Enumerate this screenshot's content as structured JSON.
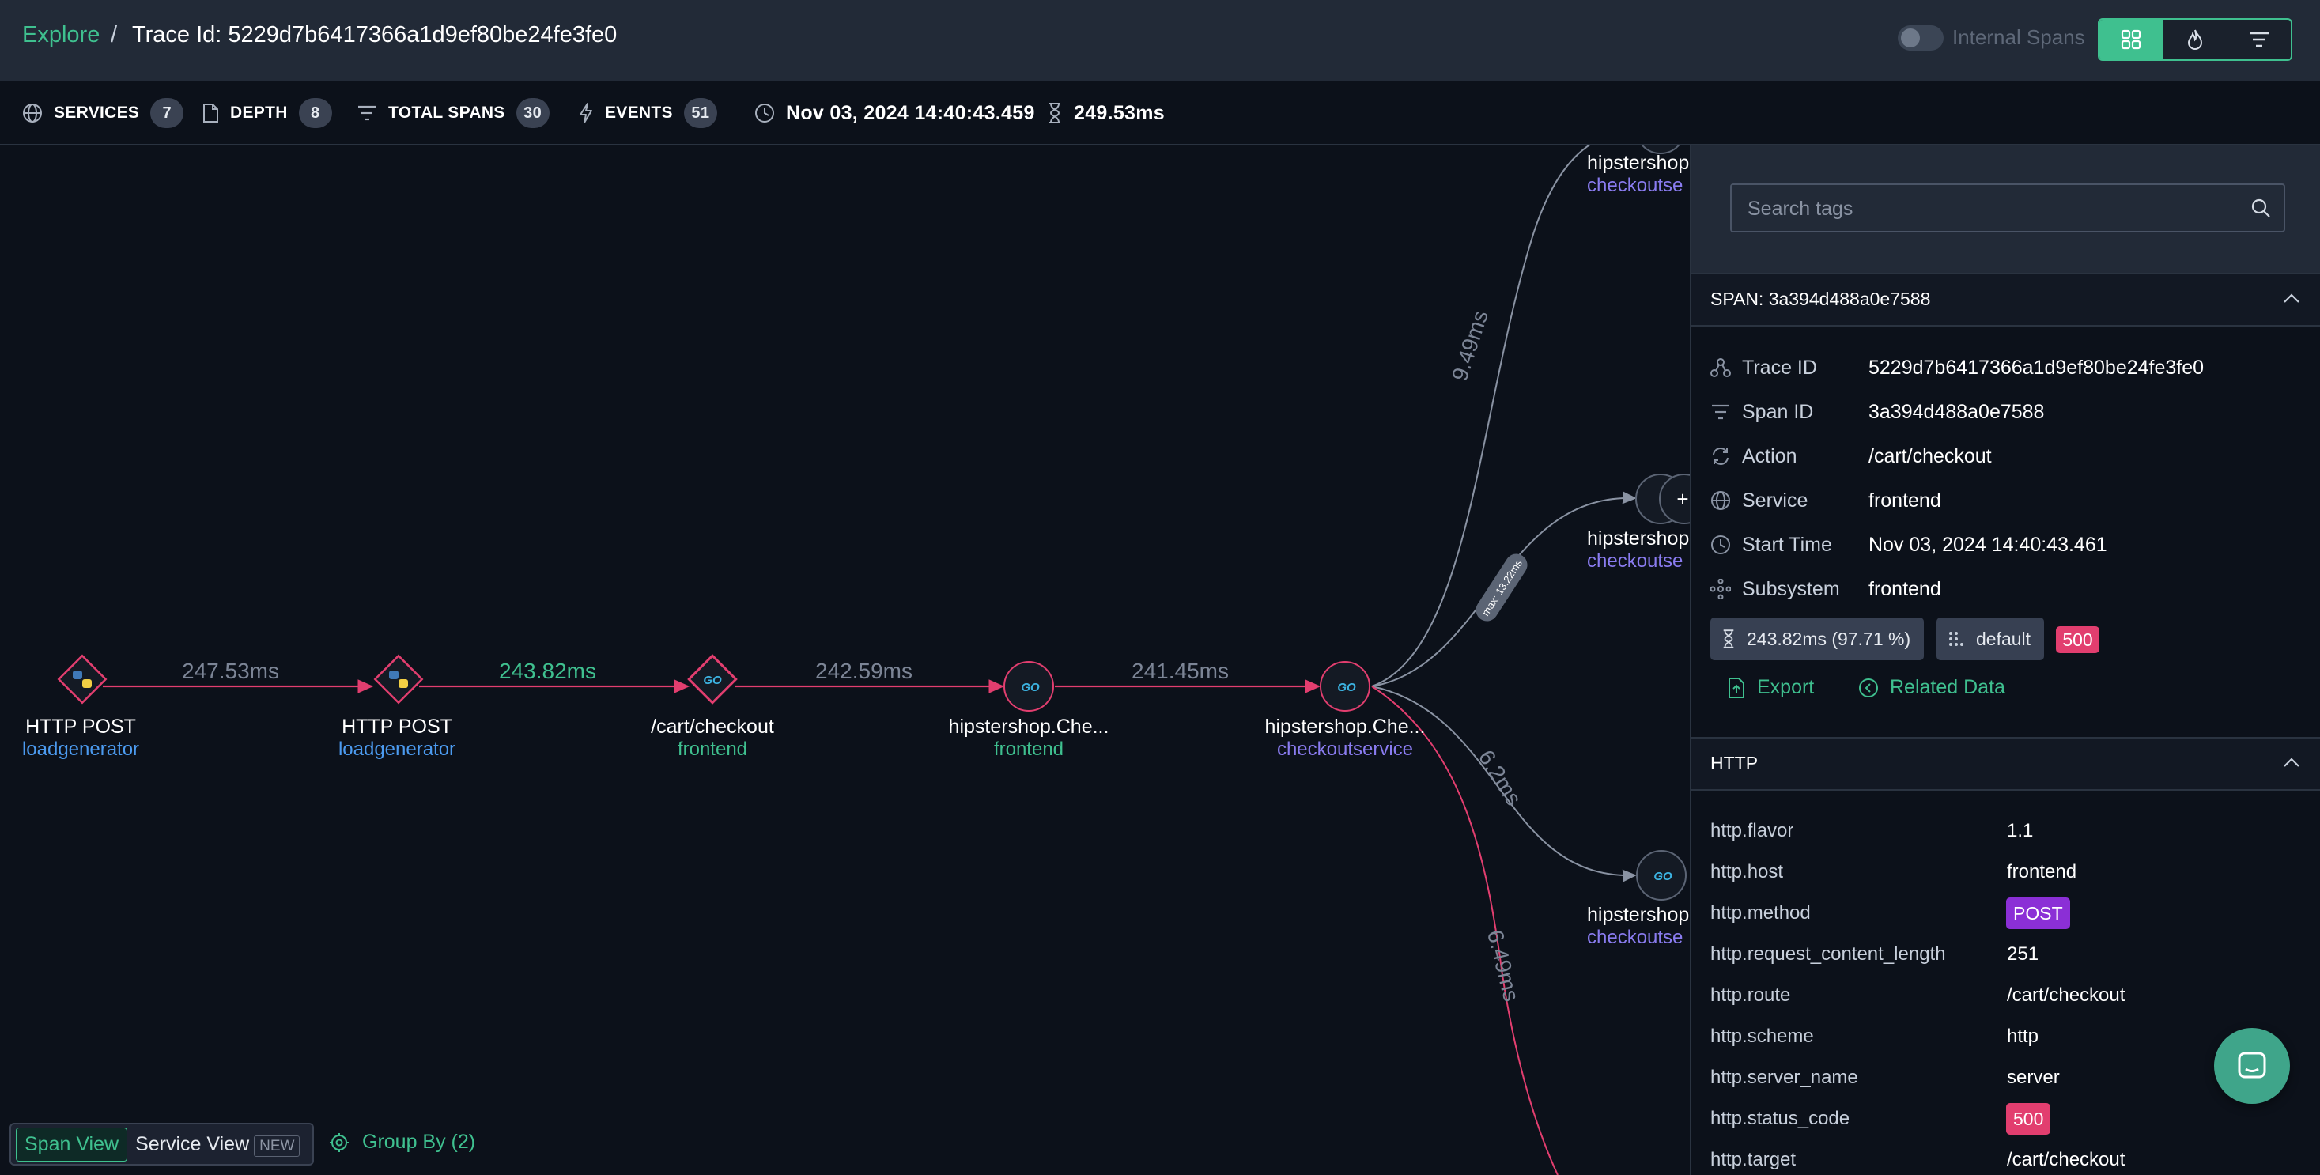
{
  "header": {
    "breadcrumb_root": "Explore",
    "separator": "/",
    "trace_title": "Trace Id: 5229d7b6417366a1d9ef80be24fe3fe0",
    "internal_spans_label": "Internal Spans",
    "internal_spans_enabled": false,
    "view_buttons": [
      "graph-view-icon",
      "flame-view-icon",
      "list-view-icon"
    ],
    "active_view": "graph-view-icon"
  },
  "stats": {
    "services_label": "SERVICES",
    "services_count": "7",
    "depth_label": "DEPTH",
    "depth_count": "8",
    "spans_label": "TOTAL SPANS",
    "spans_count": "30",
    "events_label": "EVENTS",
    "events_count": "51",
    "start_time": "Nov 03, 2024 14:40:43.459",
    "duration": "249.53ms"
  },
  "graph": {
    "nodes": [
      {
        "title": "HTTP POST",
        "service": "loadgenerator",
        "icon": "python-icon"
      },
      {
        "title": "HTTP POST",
        "service": "loadgenerator",
        "icon": "python-icon"
      },
      {
        "title": "/cart/checkout",
        "service": "frontend",
        "icon": "go-icon"
      },
      {
        "title": "hipstershop.Che...",
        "service": "frontend",
        "icon": "go-icon"
      },
      {
        "title": "hipstershop.Che...",
        "service": "checkoutservice",
        "icon": "go-icon"
      },
      {
        "title": "hipstershop",
        "service": "checkoutse",
        "icon": "go-icon"
      },
      {
        "title": "hipstershop",
        "service": "checkoutse",
        "icon": "go-icon"
      },
      {
        "title": "hipstershop",
        "service": "checkoutse",
        "icon": "go-icon"
      }
    ],
    "edges": [
      "247.53ms",
      "243.82ms",
      "242.59ms",
      "241.45ms",
      "9.49ms",
      "max: 13.22ms",
      "6.2ms",
      "6.49ms"
    ],
    "colors": {
      "error": "#e23e6f",
      "highlight": "#3fc08f",
      "muted": "#7c8596",
      "frontend": "#3fc08f",
      "loadgenerator": "#4c9bf0",
      "checkoutservice": "#8a7cf0"
    }
  },
  "bottom": {
    "span_view": "Span View",
    "service_view": "Service View",
    "new_tag": "NEW",
    "group_by": "Group By (2)"
  },
  "panel": {
    "search_placeholder": "Search tags",
    "span_section": "SPAN: 3a394d488a0e7588",
    "fields": [
      {
        "icon": "trace-icon",
        "key": "Trace ID",
        "value": "5229d7b6417366a1d9ef80be24fe3fe0"
      },
      {
        "icon": "span-icon",
        "key": "Span ID",
        "value": "3a394d488a0e7588"
      },
      {
        "icon": "action-icon",
        "key": "Action",
        "value": "/cart/checkout"
      },
      {
        "icon": "globe-icon",
        "key": "Service",
        "value": "frontend"
      },
      {
        "icon": "clock-icon",
        "key": "Start Time",
        "value": "Nov 03, 2024 14:40:43.461"
      },
      {
        "icon": "subsystem-icon",
        "key": "Subsystem",
        "value": "frontend"
      }
    ],
    "duration_chip": "243.82ms (97.71 %)",
    "default_chip": "default",
    "status_badge": "500",
    "export_label": "Export",
    "related_label": "Related Data",
    "http_section": "HTTP",
    "http_rows": [
      {
        "key": "http.flavor",
        "value": "1.1"
      },
      {
        "key": "http.host",
        "value": "frontend"
      },
      {
        "key": "http.method",
        "value": "POST"
      },
      {
        "key": "http.request_content_length",
        "value": "251"
      },
      {
        "key": "http.route",
        "value": "/cart/checkout"
      },
      {
        "key": "http.scheme",
        "value": "http"
      },
      {
        "key": "http.server_name",
        "value": "server"
      },
      {
        "key": "http.status_code",
        "value": "500"
      },
      {
        "key": "http.target",
        "value": "/cart/checkout"
      }
    ]
  }
}
